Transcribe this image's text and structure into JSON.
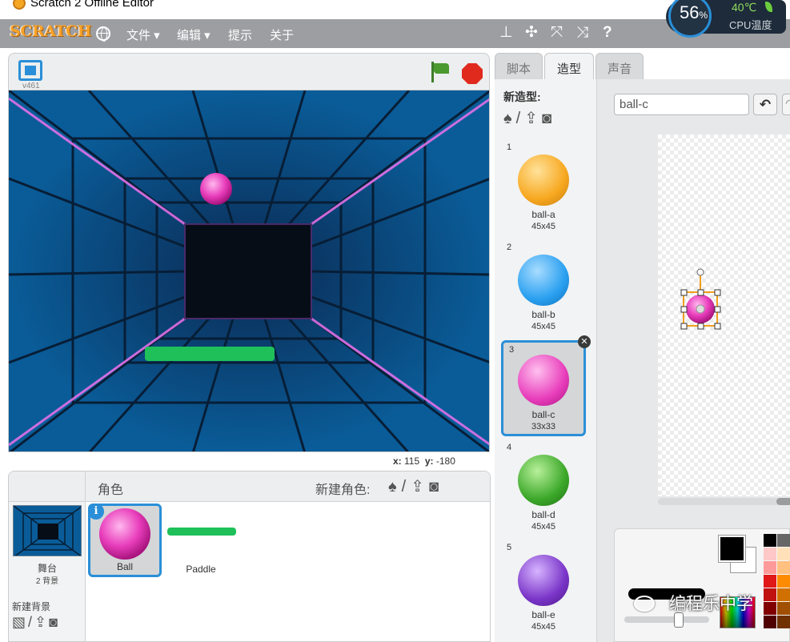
{
  "window": {
    "title": "Scratch 2 Offline Editor"
  },
  "menubar": {
    "logo": "SCRATCH",
    "items": [
      "文件 ▾",
      "编辑 ▾",
      "提示",
      "关于"
    ],
    "tools": [
      "duplicate-stamp-icon",
      "cut-scissors-icon",
      "grow-icon",
      "shrink-icon",
      "help-icon"
    ]
  },
  "cpu_widget": {
    "percent": "56",
    "percent_unit": "%",
    "temperature": "40℃",
    "label": "CPU温度"
  },
  "stage": {
    "version": "v461",
    "coords": {
      "x_label": "x:",
      "x_value": "115",
      "y_label": "y:",
      "y_value": "-180"
    }
  },
  "sprites_pane": {
    "title": "角色",
    "new_sprite_label": "新建角色:",
    "stage_label": "舞台",
    "stage_backdrops": "2 背景",
    "new_backdrop_label": "新建背景",
    "sprites": [
      {
        "name": "Ball",
        "selected": true
      },
      {
        "name": "Paddle",
        "selected": false
      }
    ]
  },
  "tabs": [
    {
      "label": "脚本",
      "active": false
    },
    {
      "label": "造型",
      "active": true
    },
    {
      "label": "声音",
      "active": false
    }
  ],
  "costumes": {
    "new_costume_label": "新造型:",
    "items": [
      {
        "index": "1",
        "name": "ball-a",
        "size": "45x45",
        "color": "#f7a820",
        "selected": false
      },
      {
        "index": "2",
        "name": "ball-b",
        "size": "45x45",
        "color": "#2aa0f0",
        "selected": false
      },
      {
        "index": "3",
        "name": "ball-c",
        "size": "33x33",
        "color": "#e83dbb",
        "selected": true
      },
      {
        "index": "4",
        "name": "ball-d",
        "size": "45x45",
        "color": "#3ca82a",
        "selected": false
      },
      {
        "index": "5",
        "name": "ball-e",
        "size": "45x45",
        "color": "#7a35c8",
        "selected": false
      }
    ]
  },
  "editor": {
    "costume_name": "ball-c"
  },
  "watermark": "编程乐中学",
  "colors": {
    "accent": "#2a8fd8",
    "menubar": "#9c9ea1",
    "paddle": "#1fc05a"
  }
}
